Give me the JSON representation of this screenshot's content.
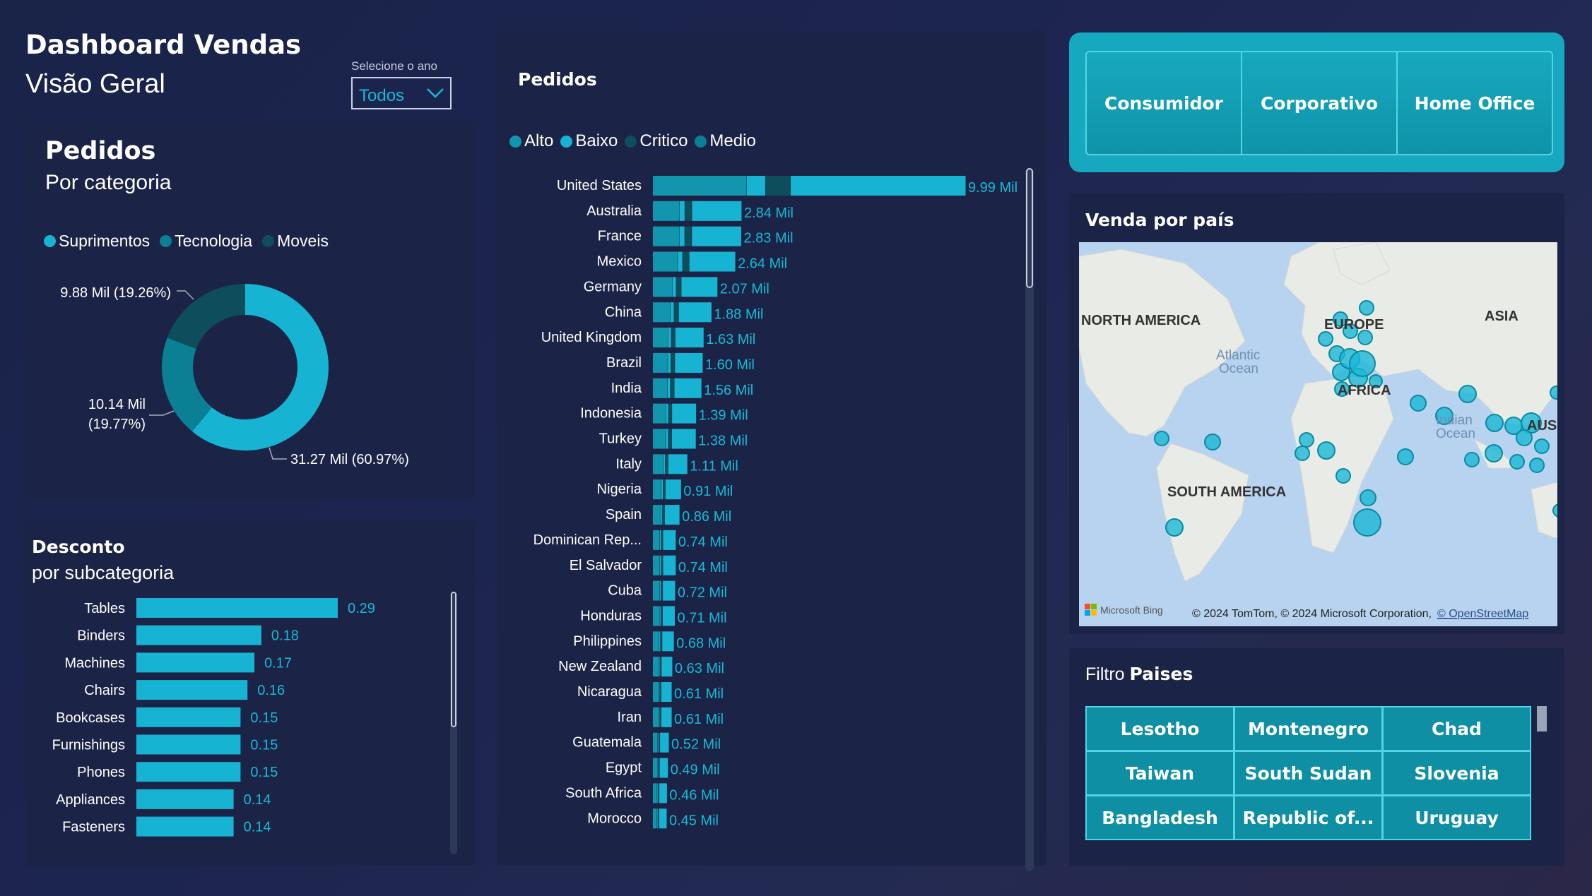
{
  "header": {
    "title": "Dashboard Vendas",
    "subtitle": "Visão Geral"
  },
  "year_filter": {
    "label": "Selecione o ano",
    "value": "Todos"
  },
  "category_panel": {
    "title": "Pedidos",
    "subtitle": "Por categoria"
  },
  "discount_panel": {
    "title": "Desconto",
    "subtitle": "por subcategoria"
  },
  "orders_panel": {
    "title": "Pedidos"
  },
  "segments": [
    "Consumidor",
    "Corporativo",
    "Home Office"
  ],
  "map_panel": {
    "title": "Venda por país",
    "labels": {
      "north_america": "NORTH AMERICA",
      "south_america": "SOUTH AMERICA",
      "europe": "EUROPE",
      "asia": "ASIA",
      "africa": "AFRICA",
      "atlantic": "Atlantic",
      "atlantic2": "Ocean",
      "indian": "Indian",
      "indian2": "Ocean",
      "aus": "AUS"
    },
    "bing": "Microsoft Bing",
    "copyright": "© 2024 TomTom, © 2024 Microsoft Corporation,",
    "osm": "© OpenStreetMap"
  },
  "country_filter": {
    "title_prefix": "Filtro",
    "title_bold": "Paises",
    "tiles": [
      "Lesotho",
      "Montenegro",
      "Chad",
      "Taiwan",
      "South Sudan",
      "Slovenia",
      "Bangladesh",
      "Republic of...",
      "Uruguay"
    ]
  },
  "colors": {
    "primary": "#16b4d2",
    "secondary": "#0b7f93",
    "dark": "#0d4d5c",
    "mid": "#1296ad",
    "panel": "#1b2446",
    "text_value": "#1ab8d6"
  },
  "chart_data": [
    {
      "type": "donut",
      "title": "Pedidos",
      "subtitle": "Por categoria",
      "legend": [
        "Suprimentos",
        "Tecnologia",
        "Moveis"
      ],
      "series": [
        {
          "name": "Suprimentos",
          "value": 31.27,
          "label": "31.27 Mil (60.97%)",
          "color": "#16b4d2"
        },
        {
          "name": "Tecnologia",
          "value": 10.14,
          "label_line1": "10.14 Mil",
          "label_line2": "(19.77%)",
          "color": "#0b7f93"
        },
        {
          "name": "Moveis",
          "value": 9.88,
          "label": "9.88 Mil (19.26%)",
          "color": "#0d4d5c"
        }
      ]
    },
    {
      "type": "bar",
      "orientation": "horizontal",
      "title": "Desconto",
      "subtitle": "por subcategoria",
      "categories": [
        "Tables",
        "Binders",
        "Machines",
        "Chairs",
        "Bookcases",
        "Furnishings",
        "Phones",
        "Appliances",
        "Fasteners"
      ],
      "values": [
        0.29,
        0.18,
        0.17,
        0.16,
        0.15,
        0.15,
        0.15,
        0.14,
        0.14
      ],
      "labels": [
        "0.29",
        "0.18",
        "0.17",
        "0.16",
        "0.15",
        "0.15",
        "0.15",
        "0.14",
        "0.14"
      ]
    },
    {
      "type": "bar",
      "orientation": "horizontal",
      "stacked": true,
      "title": "Pedidos",
      "legend": [
        "Alto",
        "Baixo",
        "Critico",
        "Medio"
      ],
      "categories": [
        "United States",
        "Australia",
        "France",
        "Mexico",
        "Germany",
        "China",
        "United Kingdom",
        "Brazil",
        "India",
        "Indonesia",
        "Turkey",
        "Italy",
        "Nigeria",
        "Spain",
        "Dominican Rep...",
        "El Salvador",
        "Cuba",
        "Honduras",
        "Philippines",
        "New Zealand",
        "Nicaragua",
        "Iran",
        "Guatemala",
        "Egypt",
        "South Africa",
        "Morocco"
      ],
      "values": [
        9.99,
        2.84,
        2.83,
        2.64,
        2.07,
        1.88,
        1.63,
        1.6,
        1.56,
        1.39,
        1.38,
        1.11,
        0.91,
        0.86,
        0.74,
        0.74,
        0.72,
        0.71,
        0.68,
        0.63,
        0.61,
        0.61,
        0.52,
        0.49,
        0.46,
        0.45
      ],
      "labels": [
        "9.99 Mil",
        "2.84 Mil",
        "2.83 Mil",
        "2.64 Mil",
        "2.07 Mil",
        "1.88 Mil",
        "1.63 Mil",
        "1.60 Mil",
        "1.56 Mil",
        "1.39 Mil",
        "1.38 Mil",
        "1.11 Mil",
        "0.91 Mil",
        "0.86 Mil",
        "0.74 Mil",
        "0.74 Mil",
        "0.72 Mil",
        "0.71 Mil",
        "0.68 Mil",
        "0.63 Mil",
        "0.61 Mil",
        "0.61 Mil",
        "0.52 Mil",
        "0.49 Mil",
        "0.46 Mil",
        "0.45 Mil"
      ]
    }
  ]
}
